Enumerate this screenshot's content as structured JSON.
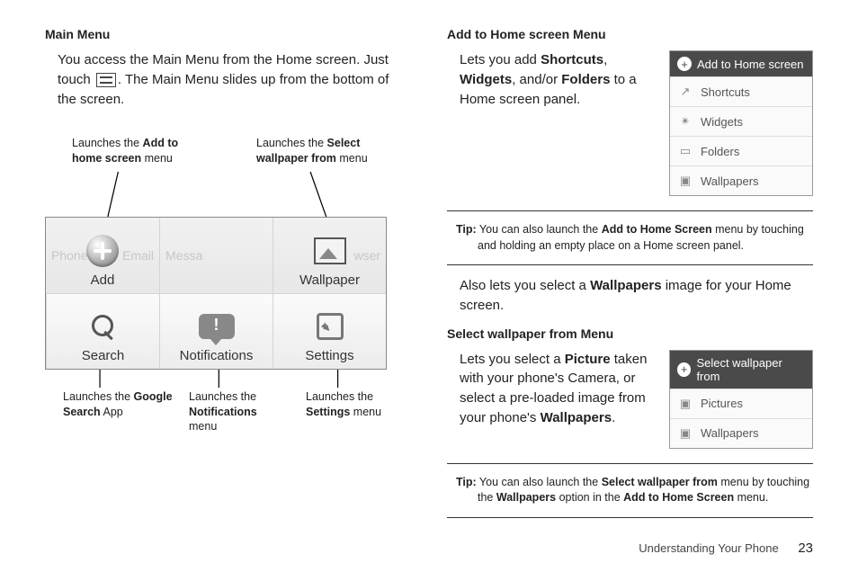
{
  "left": {
    "heading": "Main Menu",
    "para_pre": "You access the Main Menu from the Home screen. Just touch ",
    "para_post": ". The Main Menu slides up from the bottom of the screen.",
    "callouts": {
      "top_left_pre": "Launches the ",
      "top_left_bold": "Add to home screen",
      "top_left_post": " menu",
      "top_right_pre": "Launches the ",
      "top_right_bold": "Select wallpaper from",
      "top_right_post": " menu",
      "bot_left_pre": "Launches the ",
      "bot_left_bold": "Google Search",
      "bot_left_post": " App",
      "bot_mid_pre": "Launches the ",
      "bot_mid_bold": "Notifications",
      "bot_mid_post": " menu",
      "bot_right_pre": "Launches the ",
      "bot_right_bold": "Settings",
      "bot_right_post": " menu"
    },
    "grid": {
      "bg_phone": "Phone",
      "bg_email": "Email",
      "bg_messa": "Messa",
      "bg_browser": "wser",
      "add": "Add",
      "wallpaper": "Wallpaper",
      "search": "Search",
      "notifications": "Notifications",
      "settings": "Settings"
    }
  },
  "right": {
    "heading1": "Add to Home screen Menu",
    "p1_a": "Lets you add ",
    "p1_b1": "Shortcuts",
    "p1_c": ", ",
    "p1_b2": "Widgets",
    "p1_d": ", and/or ",
    "p1_b3": "Folders",
    "p1_e": " to a Home screen panel.",
    "panel1": {
      "title": "Add to Home screen",
      "r1": "Shortcuts",
      "r2": "Widgets",
      "r3": "Folders",
      "r4": "Wallpapers"
    },
    "tip1_label": "Tip:",
    "tip1_a": " You can also launch the ",
    "tip1_b": "Add to Home Screen",
    "tip1_c": " menu by touching and holding an empty place on a Home screen panel.",
    "p2_a": "Also lets you select a ",
    "p2_b": "Wallpapers",
    "p2_c": " image for your Home screen.",
    "heading2": "Select wallpaper from Menu",
    "p3_a": "Lets you select a ",
    "p3_b1": "Picture",
    "p3_c": " taken with your phone's Camera, or select a pre-loaded image from your phone's ",
    "p3_b2": "Wallpapers",
    "p3_d": ".",
    "panel2": {
      "title": "Select wallpaper from",
      "r1": "Pictures",
      "r2": "Wallpapers"
    },
    "tip2_label": "Tip:",
    "tip2_a": " You can also launch the ",
    "tip2_b": "Select wallpaper from",
    "tip2_c": " menu by touching the ",
    "tip2_d": "Wallpapers",
    "tip2_e": " option in the ",
    "tip2_f": "Add to Home Screen",
    "tip2_g": " menu."
  },
  "footer": {
    "chapter": "Understanding Your Phone",
    "page": "23"
  }
}
